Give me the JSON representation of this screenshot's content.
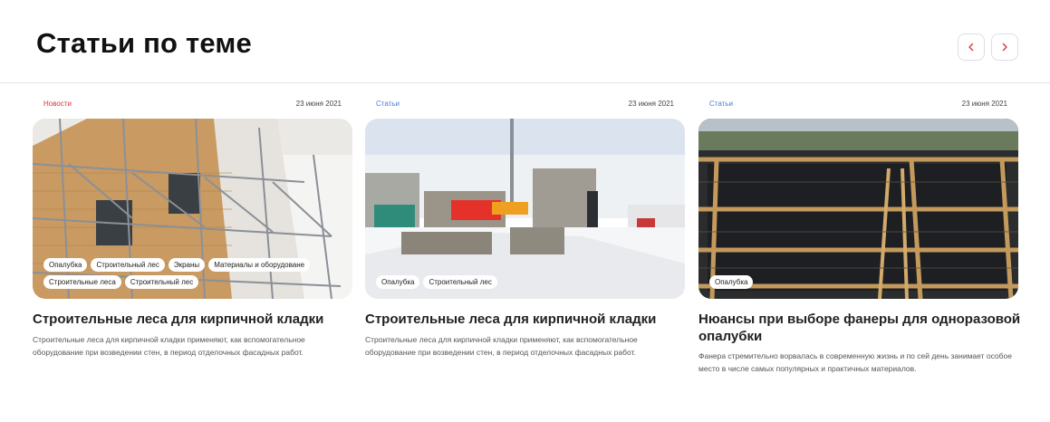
{
  "header": {
    "title": "Статьи по теме"
  },
  "colors": {
    "news": "#e0313e",
    "articles": "#4a7fd4",
    "accent": "#e0313e"
  },
  "icons": {
    "prev": "chevron-left-icon",
    "next": "chevron-right-icon"
  },
  "cards": [
    {
      "category": "Новости",
      "date": "23 июня 2021",
      "tags": [
        "Опалубка",
        "Строительный лес",
        "Экраны",
        "Материалы и оборудоване",
        "Строительные леса",
        "Строительный лес"
      ],
      "title": "Строительные леса для кирпичной кладки",
      "description": "Строительные леса для кирпичной кладки применяют, как вспомогательное оборудование при возведении стен, в период отделочных фасадных работ."
    },
    {
      "category": "Статьи",
      "date": "23 июня 2021",
      "tags": [
        "Опалубка",
        "Строительный лес"
      ],
      "title": "Строительные леса для кирпичной кладки",
      "description": "Строительные леса для кирпичной кладки применяют, как вспомогательное оборудование при возведении стен, в период отделочных фасадных работ."
    },
    {
      "category": "Статьи",
      "date": "23 июня 2021",
      "tags": [
        "Опалубка"
      ],
      "title": "Нюансы при выборе фанеры для одноразовой опалубки",
      "description": "Фанера стремительно ворвалась в современную жизнь и по сей день занимает особое место в числе самых популярных и практичных материалов."
    }
  ]
}
